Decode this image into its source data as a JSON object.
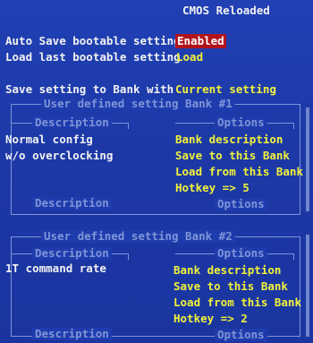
{
  "title": "CMOS Reloaded",
  "settings": {
    "auto_save_label": "Auto Save bootable setting",
    "auto_save_value": "Enabled",
    "load_last_label": "Load last bootable setting",
    "load_last_value": "Load",
    "save_bank_label": "Save setting to Bank with",
    "save_bank_value": "Current setting"
  },
  "banks": [
    {
      "title": "User defined setting Bank #1",
      "description_header": "Description",
      "options_header": "Options",
      "description_lines": [
        "Normal config",
        "w/o overclocking"
      ],
      "options": [
        "Bank description",
        "Save to this Bank",
        "Load from this Bank",
        "Hotkey => 5"
      ],
      "footer_description": "Description",
      "footer_options": "Options"
    },
    {
      "title": "User defined setting Bank #2",
      "description_header": "Description",
      "options_header": "Options",
      "description_lines": [
        "1T command rate"
      ],
      "options": [
        "Bank description",
        "Save to this Bank",
        "Load from this Bank",
        "Hotkey => 2"
      ],
      "footer_description": "Description",
      "footer_options": "Options"
    }
  ],
  "colors": {
    "background": "#1d3aa8",
    "text": "#f2f2f2",
    "option": "#f2f23a",
    "frame": "#7f95d8",
    "highlight": "#b2141c"
  }
}
